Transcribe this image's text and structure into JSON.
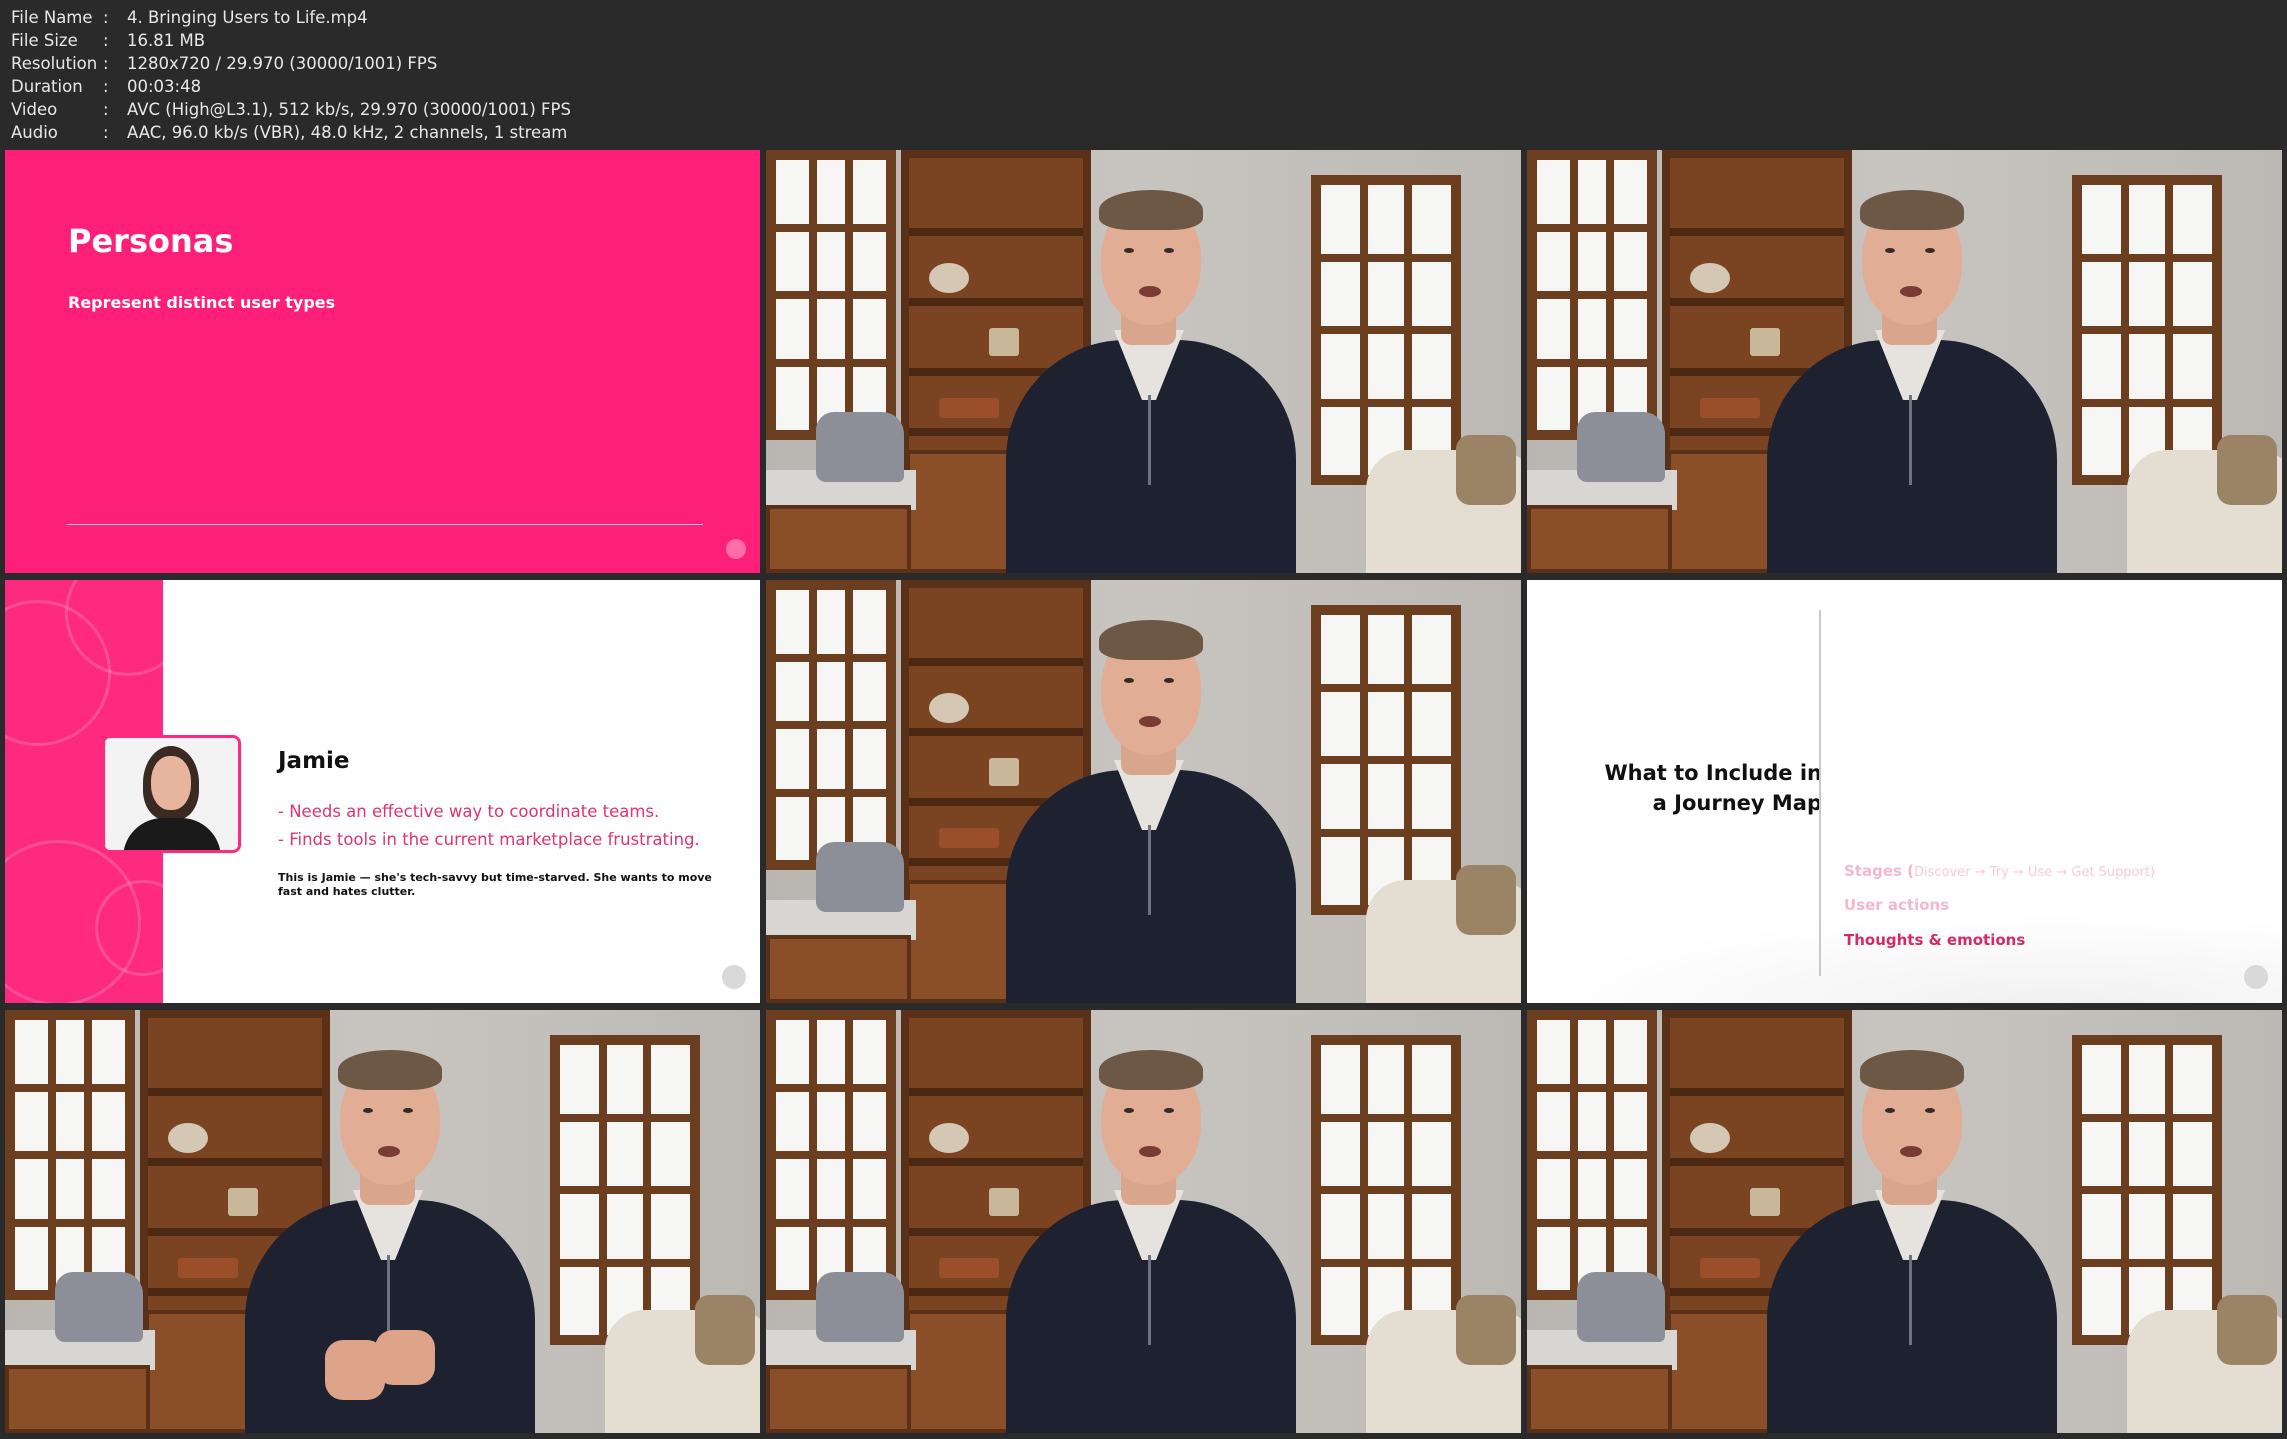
{
  "file_info": {
    "rows": [
      {
        "label": "File Name",
        "value": "4. Bringing Users to Life.mp4"
      },
      {
        "label": "File Size",
        "value": "16.81 MB"
      },
      {
        "label": "Resolution",
        "value": "1280x720 / 29.970 (30000/1001) FPS"
      },
      {
        "label": "Duration",
        "value": "00:03:48"
      },
      {
        "label": "Video",
        "value": "AVC (High@L3.1), 512 kb/s, 29.970 (30000/1001) FPS"
      },
      {
        "label": "Audio",
        "value": "AAC, 96.0 kb/s (VBR), 48.0 kHz, 2 channels, 1 stream"
      }
    ]
  },
  "thumbnails": {
    "slide_personas": {
      "title": "Personas",
      "subtitle": "Represent distinct user types"
    },
    "slide_jamie": {
      "name": "Jamie",
      "points": [
        "- Needs an effective way to coordinate teams.",
        "- Finds tools in the current marketplace frustrating."
      ],
      "body": "This is Jamie — she's tech-savvy but time-starved. She wants to move fast and hates clutter."
    },
    "slide_journey": {
      "title_line1": "What to Include in",
      "title_line2": "a Journey Map",
      "stages_label": "Stages (",
      "stages_detail": "Discover → Try → Use → Get Support)",
      "item2": "User actions",
      "item3": "Thoughts & emotions"
    }
  },
  "colors": {
    "brand_pink": "#fe1f78",
    "accent_text": "#d62a68"
  }
}
